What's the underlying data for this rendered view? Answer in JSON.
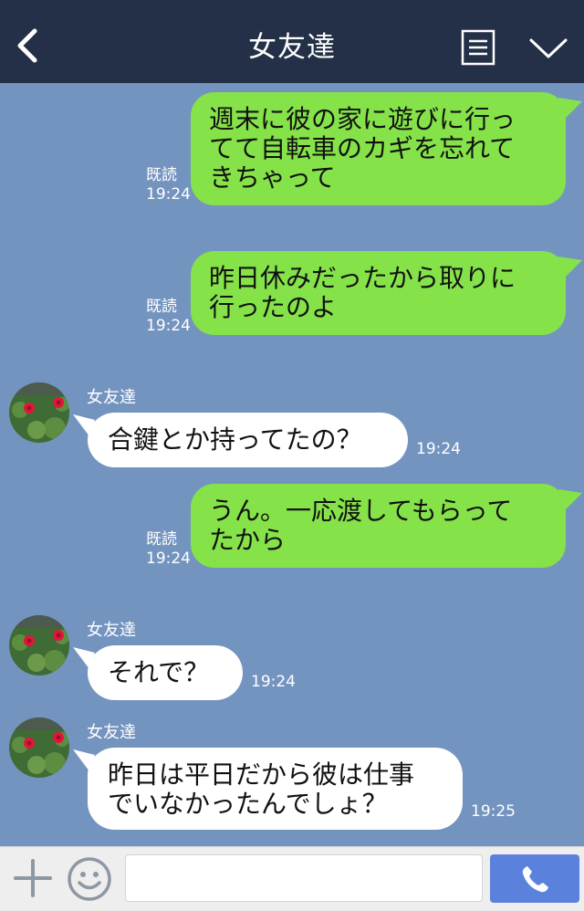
{
  "header": {
    "title": "女友達"
  },
  "messages": [
    {
      "side": "out",
      "text_lines": [
        "週末に彼の家に遊びに行っ",
        "てて自転車のカギを忘れて",
        "きちゃって"
      ],
      "read": "既読",
      "time": "19:24"
    },
    {
      "side": "out",
      "text_lines": [
        "昨日休みだったから取りに",
        "行ったのよ"
      ],
      "read": "既読",
      "time": "19:24"
    },
    {
      "side": "in",
      "sender": "女友達",
      "text_lines": [
        "合鍵とか持ってたの？"
      ],
      "time": "19:24"
    },
    {
      "side": "out",
      "text_lines": [
        "うん。一応渡してもらって",
        "たから"
      ],
      "read": "既読",
      "time": "19:24"
    },
    {
      "side": "in",
      "sender": "女友達",
      "text_lines": [
        "それで？"
      ],
      "time": "19:24"
    },
    {
      "side": "in",
      "sender": "女友達",
      "text_lines": [
        "昨日は平日だから彼は仕事",
        "でいなかったんでしょ？"
      ],
      "time": "19:25"
    }
  ],
  "colors": {
    "header_bg": "#243048",
    "chat_bg": "#7494c0",
    "outgoing_bubble": "#85e249",
    "incoming_bubble": "#ffffff",
    "call_button": "#5a82dc"
  },
  "icons": {
    "back": "chevron-left-icon",
    "menu": "menu-list-icon",
    "collapse": "chevron-down-icon",
    "add": "plus-icon",
    "emoji": "smiley-icon",
    "call": "phone-icon"
  }
}
